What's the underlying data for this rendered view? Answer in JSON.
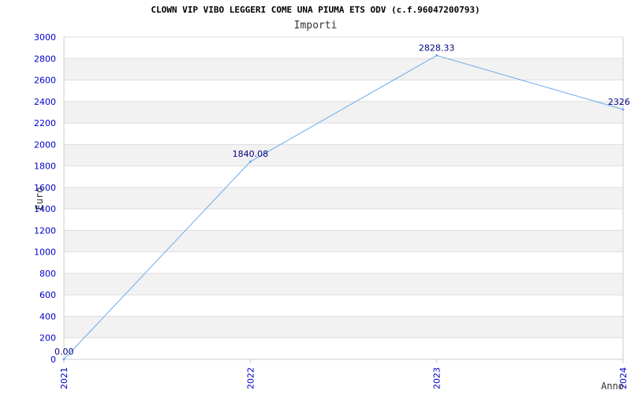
{
  "chart_data": {
    "type": "line",
    "title": "CLOWN VIP VIBO LEGGERI COME UNA PIUMA ETS ODV (c.f.96047200793)",
    "subtitle": "Importi",
    "ylabel": "Euro",
    "xlabel": "Anno",
    "categories": [
      "2021",
      "2022",
      "2023",
      "2024"
    ],
    "series": [
      {
        "values": [
          0.0,
          1840.08,
          2828.33,
          2326.0
        ],
        "labels": [
          "0.00",
          "1840.08",
          "2828.33",
          "2326.0"
        ]
      }
    ],
    "yticks": [
      "0",
      "200",
      "400",
      "600",
      "800",
      "1000",
      "1200",
      "1400",
      "1600",
      "1800",
      "2000",
      "2200",
      "2400",
      "2600",
      "2800",
      "3000"
    ],
    "ylim": [
      0,
      3000
    ],
    "grid": true,
    "colors": {
      "line": "#6aaaee",
      "tick_text": "#0000cc",
      "data_label": "#000080",
      "band": "#f2f2f2",
      "grid": "#dddddd",
      "axis": "#cccccc"
    }
  }
}
